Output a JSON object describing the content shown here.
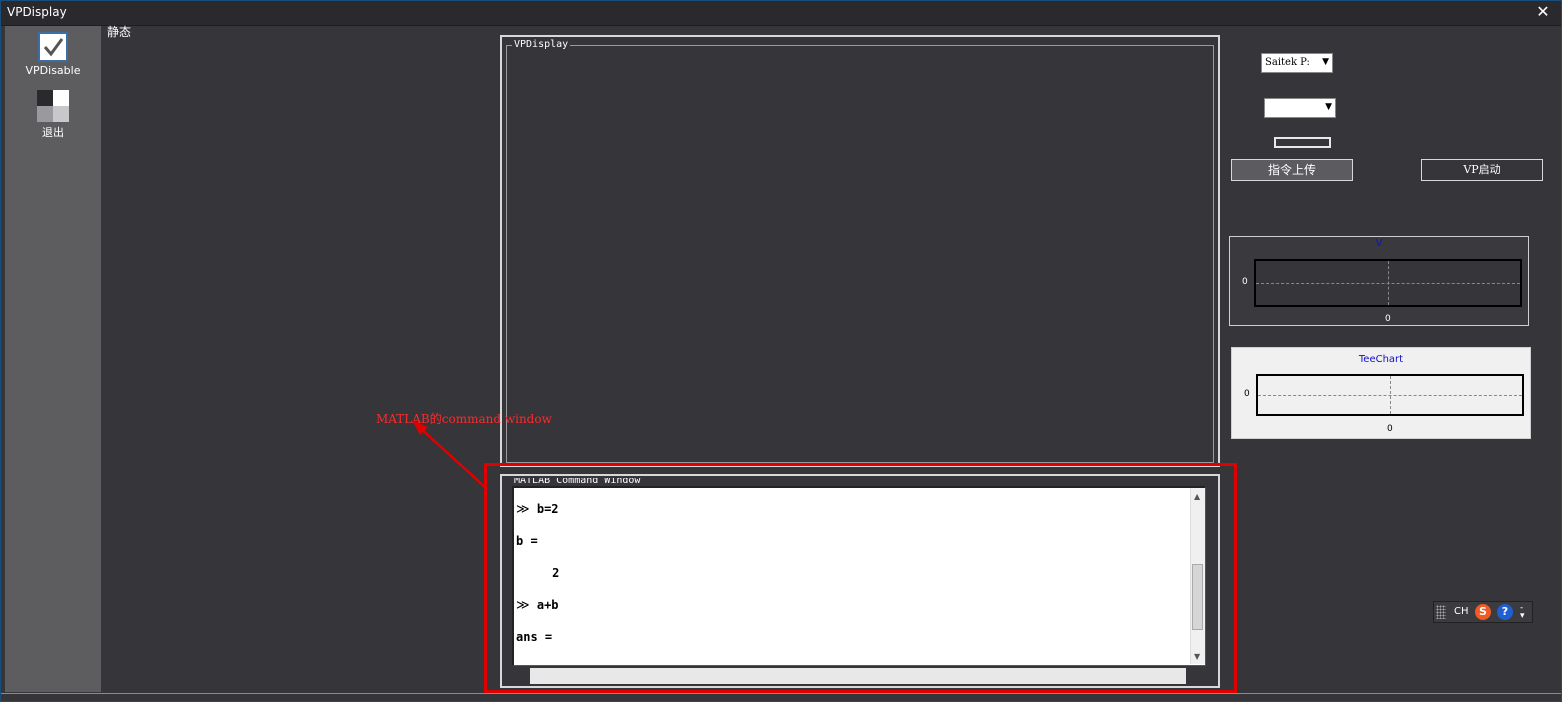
{
  "window": {
    "title": "VPDisplay",
    "close_glyph": "✕"
  },
  "sidebar": {
    "items": [
      {
        "label": "VPDisable",
        "icon": "checkbox-icon"
      },
      {
        "label": "退出",
        "icon": "exit-icon"
      }
    ]
  },
  "status_label": "静态",
  "vp_group": {
    "title": "VPDisplay"
  },
  "command_window": {
    "title": "MATLAB Command Window",
    "lines": [
      {
        "prompt": "≫",
        "text": "b=2"
      },
      {
        "prompt": "",
        "text": "b ="
      },
      {
        "prompt": "",
        "text": "     2"
      },
      {
        "prompt": "≫",
        "text": "a+b"
      },
      {
        "prompt": "",
        "text": "ans ="
      }
    ]
  },
  "annotation": {
    "text": "MATLAB的command window",
    "color": "#ff2a2a"
  },
  "controls": {
    "device_combo_value": "Saitek P:",
    "second_combo_value": "",
    "upload_button": "指令上传",
    "vp_start_button": "VP启动"
  },
  "charts": {
    "v_chart": {
      "title": "V",
      "y_tick": "0",
      "x_tick": "0"
    },
    "tee_chart": {
      "title": "TeeChart",
      "y_tick": "0",
      "x_tick": "0"
    }
  },
  "ime": {
    "label": "CH",
    "sogou": "S",
    "help": "?"
  }
}
